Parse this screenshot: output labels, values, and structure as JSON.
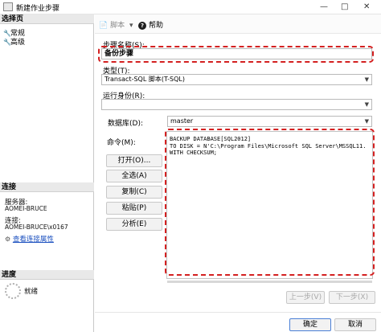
{
  "window": {
    "title": "新建作业步骤",
    "controls": [
      "—",
      "□",
      "✕"
    ]
  },
  "sidebar": {
    "select_page_header": "选择页",
    "pages": [
      {
        "label": "常规"
      },
      {
        "label": "高级"
      }
    ],
    "connection_header": "连接",
    "server_label": "服务器:",
    "server_value": "AOMEI-BRUCE",
    "connection_label": "连接:",
    "connection_value": "AOMEI-BRUCE\\x0167",
    "view_connection_link": "查看连接属性",
    "progress_header": "进度",
    "progress_status": "就绪"
  },
  "toolbar": {
    "script_label": "脚本",
    "help_label": "帮助"
  },
  "form": {
    "step_name_label": "步骤名称(S):",
    "step_name_value": "备份步骤",
    "type_label": "类型(T):",
    "type_value": "Transact-SQL 脚本(T-SQL)",
    "run_as_label": "运行身份(R):",
    "run_as_value": "",
    "database_label": "数据库(D):",
    "database_value": "master",
    "command_label": "命令(M):",
    "command_lines": [
      "BACKUP DATABASE[SQL2012]",
      "TO DISK = N'C:\\Program Files\\Microsoft SQL Server\\MSSQL11.",
      "WITH CHECKSUM;"
    ]
  },
  "buttons": {
    "open": "打开(O)...",
    "select_all": "全选(A)",
    "copy": "复制(C)",
    "paste": "粘贴(P)",
    "parse": "分析(E)",
    "prev_step": "上一步(V)",
    "next_step": "下一步(X)",
    "ok": "确定",
    "cancel": "取消"
  },
  "colors": {
    "highlight": "#d42020",
    "link": "#1a4fbf"
  }
}
